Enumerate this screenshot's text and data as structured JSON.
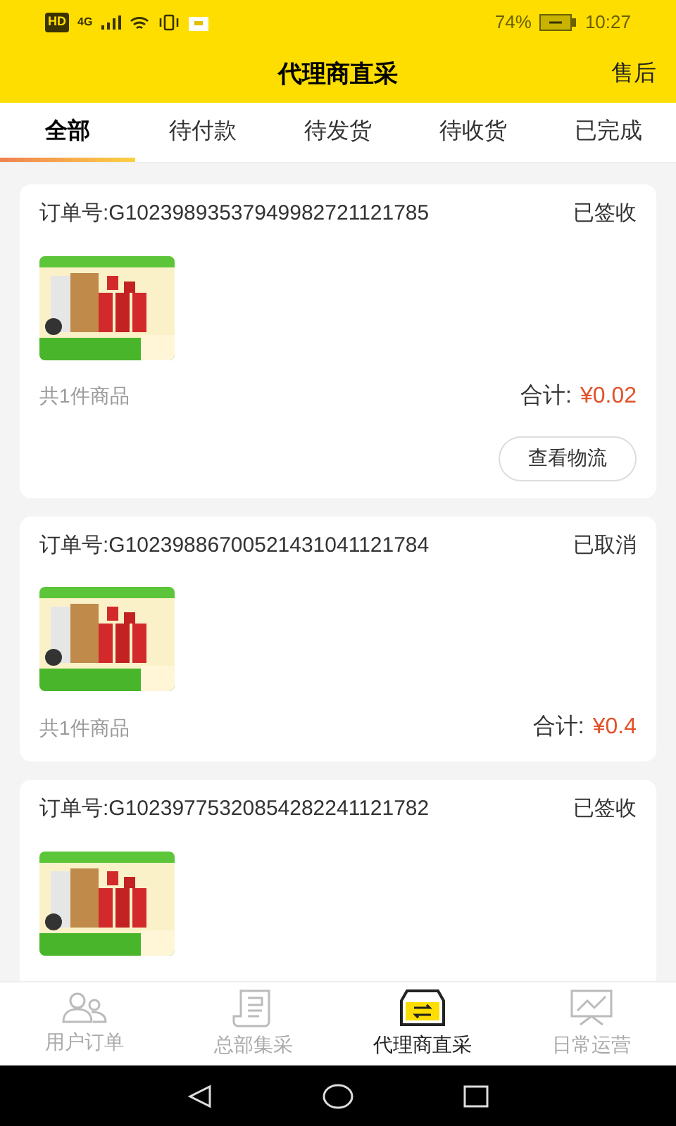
{
  "status_bar": {
    "hd": "HD",
    "network": "4G",
    "battery": "74%",
    "time": "10:27"
  },
  "header": {
    "title": "代理商直采",
    "action": "售后"
  },
  "tabs": [
    {
      "label": "全部",
      "selected": true
    },
    {
      "label": "待付款",
      "selected": false
    },
    {
      "label": "待发货",
      "selected": false
    },
    {
      "label": "待收货",
      "selected": false
    },
    {
      "label": "已完成",
      "selected": false
    }
  ],
  "orders": [
    {
      "order_no": "订单号:G10239893537949982721121785",
      "status": "已签收",
      "count": "共1件商品",
      "total_label": "合计:",
      "total": "¥0.02",
      "button": "查看物流"
    },
    {
      "order_no": "订单号:G10239886700521431041121784",
      "status": "已取消",
      "count": "共1件商品",
      "total_label": "合计:",
      "total": "¥0.4"
    },
    {
      "order_no": "订单号:G10239775320854282241121782",
      "status": "已签收"
    }
  ],
  "bottom_nav": [
    {
      "label": "用户订单",
      "selected": false
    },
    {
      "label": "总部集采",
      "selected": false
    },
    {
      "label": "代理商直采",
      "selected": true
    },
    {
      "label": "日常运营",
      "selected": false
    }
  ]
}
